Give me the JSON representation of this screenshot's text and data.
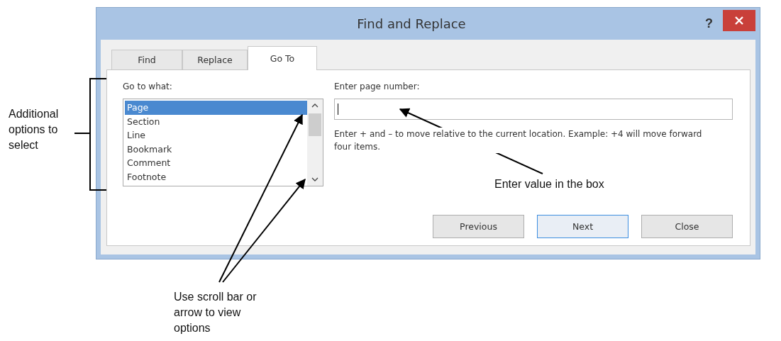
{
  "window": {
    "title": "Find and Replace",
    "help": "?"
  },
  "tabs": [
    {
      "label": "Find",
      "selected": false
    },
    {
      "label": "Replace",
      "selected": false
    },
    {
      "label": "Go To",
      "selected": true
    }
  ],
  "go_to_what": {
    "label": "Go to what:",
    "items": [
      {
        "label": "Page",
        "selected": true
      },
      {
        "label": "Section",
        "selected": false
      },
      {
        "label": "Line",
        "selected": false
      },
      {
        "label": "Bookmark",
        "selected": false
      },
      {
        "label": "Comment",
        "selected": false
      },
      {
        "label": "Footnote",
        "selected": false
      }
    ]
  },
  "page_number": {
    "label": "Enter page number:"
  },
  "hint": "Enter + and – to move relative to the current location. Example: +4 will move forward four items.",
  "buttons": [
    {
      "label": "Previous",
      "default": false
    },
    {
      "label": "Next",
      "default": true
    },
    {
      "label": "Close",
      "default": false
    }
  ],
  "callouts": [
    {
      "kind": "bracket",
      "text": "Additional options to select"
    },
    {
      "kind": "field",
      "text": "Enter value in the box"
    },
    {
      "kind": "scroll",
      "text": "Use scroll bar or arrow to view options"
    }
  ]
}
